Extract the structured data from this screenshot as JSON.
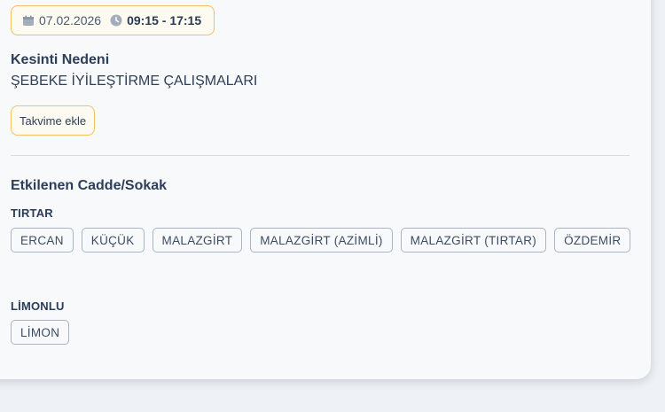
{
  "outage": {
    "date": "07.02.2026",
    "time_range": "09:15 - 17:15",
    "reason_label": "Kesinti Nedeni",
    "reason_value": "ŞEBEKE İYİLEŞTİRME ÇALIŞMALARI",
    "calendar_button_label": "Takvime ekle"
  },
  "affected": {
    "title": "Etkilenen Cadde/Sokak",
    "groups": [
      {
        "name": "TIRTAR",
        "streets": [
          "ERCAN",
          "KÜÇÜK",
          "MALAZGİRT",
          "MALAZGİRT (AZİMLİ)",
          "MALAZGİRT (TIRTAR)",
          "ÖZDEMİR"
        ]
      },
      {
        "name": "LİMONLU",
        "streets": [
          "LİMON"
        ]
      }
    ]
  },
  "icons": {
    "date": "calendar-icon",
    "time": "clock-icon"
  },
  "colors": {
    "accent_border": "#f2c060",
    "chip_border": "#a9b4c4",
    "text": "#2c3e58"
  }
}
